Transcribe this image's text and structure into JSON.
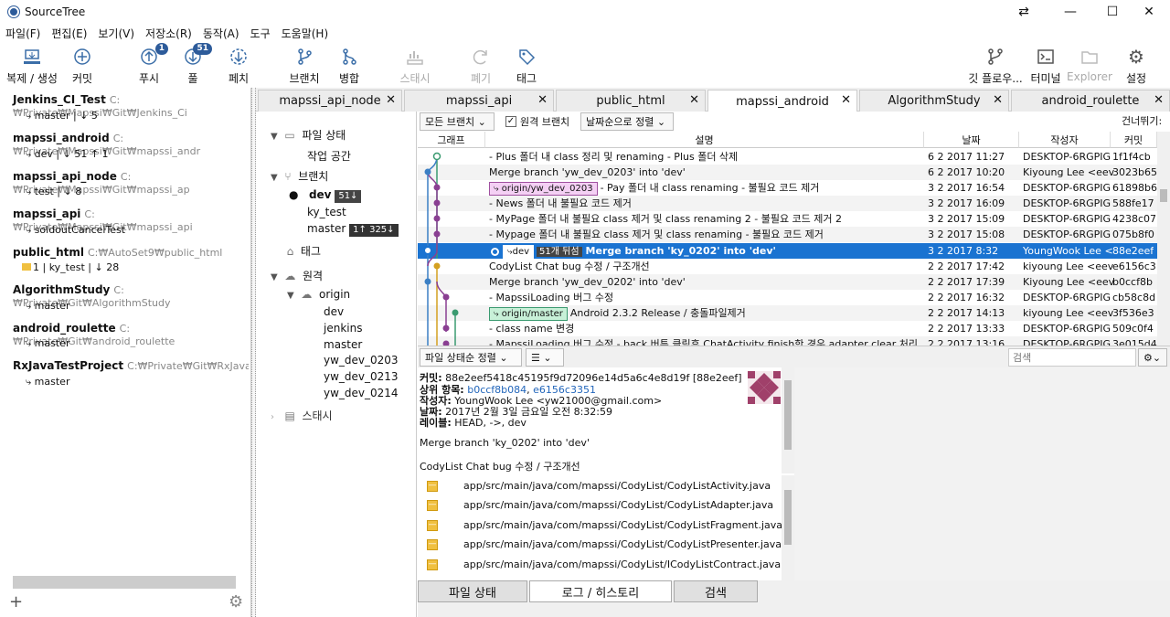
{
  "window": {
    "title": "SourceTree",
    "controls": [
      "⇄",
      "—",
      "☐",
      "✕"
    ]
  },
  "menu": [
    "파일(F)",
    "편집(E)",
    "보기(V)",
    "저장소(R)",
    "동작(A)",
    "도구",
    "도움말(H)"
  ],
  "toolbar": {
    "clone": "복제 / 생성",
    "commit": "커밋",
    "push": "푸시",
    "push_badge": "1",
    "pull": "풀",
    "pull_badge": "51",
    "fetch": "페치",
    "branch": "브랜치",
    "merge": "병합",
    "stash": "스태시",
    "discard": "폐기",
    "tag": "태그",
    "gitflow": "깃 플로우...",
    "terminal": "터미널",
    "explorer": "Explorer",
    "settings": "설정"
  },
  "repos": [
    {
      "name": "Jenkins_CI_Test",
      "path": "C:₩Private₩Mapssi₩Git₩Jenkins_Ci",
      "branch": "master  |  ↓ 5"
    },
    {
      "name": "mapssi_android",
      "path": "C:₩Private₩Mapssi₩Git₩mapssi_andr",
      "branch": "dev  |  ↓ 51  ↑ 1"
    },
    {
      "name": "mapssi_api_node",
      "path": "C:₩Private₩Mapssi₩Git₩mapssi_ap",
      "branch": "test  |  ↓ 8"
    },
    {
      "name": "mapssi_api",
      "path": "C:₩Private₩Mapssi₩Git₩mapssi_api",
      "branch": "soldoutCancelTest"
    },
    {
      "name": "public_html",
      "path": "C:₩AutoSet9₩public_html",
      "branch": "1  |  ky_test  |  ↓ 28"
    },
    {
      "name": "AlgorithmStudy",
      "path": "C:₩Private₩Git₩AlgorithmStudy",
      "branch": "master"
    },
    {
      "name": "android_roulette",
      "path": "C:₩Private₩Git₩android_roulette",
      "branch": "master"
    },
    {
      "name": "RxJavaTestProject",
      "path": "C:₩Private₩Git₩RxJavaTestProjec",
      "branch": "master"
    }
  ],
  "left_footer": {
    "add": "+",
    "gear": "⚙"
  },
  "tabs": [
    "mapssi_api_node",
    "mapssi_api",
    "public_html",
    "mapssi_android",
    "AlgorithmStudy",
    "android_roulette"
  ],
  "sidebar": {
    "file_status": "파일 상태",
    "workspace": "작업 공간",
    "branches": "브랜치",
    "dev": "dev",
    "dev_count": "51↓",
    "ky_test": "ky_test",
    "master": "master",
    "master_count": "1↑ 325↓",
    "tags": "태그",
    "remotes": "원격",
    "origin": "origin",
    "remote_branches": [
      "dev",
      "jenkins",
      "master",
      "yw_dev_0203",
      "yw_dev_0213",
      "yw_dev_0214"
    ],
    "stash": "스태시"
  },
  "filters": {
    "all_branches": "모든 브랜치",
    "remote_branches": "원격 브랜치",
    "sort": "날짜순으로 정렬",
    "skip": "건너뛰기:"
  },
  "grid": {
    "headers": [
      "그래프",
      "설명",
      "날짜",
      "작성자",
      "커밋"
    ],
    "rows": [
      {
        "tags": [],
        "desc": "- Plus 폴더 내 class 정리 및 renaming - Plus 폴더 삭제",
        "date": "6 2 2017 11:27",
        "author": "DESKTOP-6RGPIG",
        "commit": "1f1f4cb"
      },
      {
        "tags": [],
        "desc": "Merge branch 'yw_dev_0203' into 'dev'",
        "date": "6 2 2017 10:20",
        "author": "Kiyoung Lee <eev",
        "commit": "3023b65"
      },
      {
        "tags": [
          "origin/yw_dev_0203"
        ],
        "desc": "- Pay 폴더 내 class renaming - 불필요 코드 제거",
        "date": "3 2 2017 16:54",
        "author": "DESKTOP-6RGPIG",
        "commit": "61898b6"
      },
      {
        "tags": [],
        "desc": "- News 폴더 내 불필요 코드 제거",
        "date": "3 2 2017 16:09",
        "author": "DESKTOP-6RGPIG",
        "commit": "588fe17"
      },
      {
        "tags": [],
        "desc": "- MyPage 폴더 내 불필요 class 제거 및 class renaming 2 - 불필요  코드 제거 2",
        "date": "3 2 2017 15:09",
        "author": "DESKTOP-6RGPIG",
        "commit": "4238c07"
      },
      {
        "tags": [],
        "desc": "- Mypage 폴더 내 불필요 class 제거 및 class renaming - 불필요 코드 제거",
        "date": "3 2 2017 15:08",
        "author": "DESKTOP-6RGPIG",
        "commit": "075b8f0"
      },
      {
        "tags": [
          "dev",
          "51개 뒤섬"
        ],
        "desc": "Merge branch 'ky_0202' into 'dev'",
        "date": "3 2 2017 8:32",
        "author": "YoungWook Lee <",
        "commit": "88e2eef"
      },
      {
        "tags": [],
        "desc": "CodyList Chat bug 수정 / 구조개선",
        "date": "2 2 2017 17:42",
        "author": "kiyoung Lee <eev",
        "commit": "e6156c3"
      },
      {
        "tags": [],
        "desc": "Merge branch 'yw_dev_0202' into 'dev'",
        "date": "2 2 2017 17:39",
        "author": "Kiyoung Lee <eev",
        "commit": "b0ccf8b"
      },
      {
        "tags": [],
        "desc": "- MapssiLoading 버그 수정",
        "date": "2 2 2017 16:32",
        "author": "DESKTOP-6RGPIG",
        "commit": "cb58c8d"
      },
      {
        "tags": [
          "origin/master"
        ],
        "desc": "Android 2.3.2 Release / 충돌파일제거",
        "date": "2 2 2017 14:13",
        "author": "kiyoung Lee <eev",
        "commit": "3f536e3"
      },
      {
        "tags": [],
        "desc": "- class name 변경",
        "date": "2 2 2017 13:33",
        "author": "DESKTOP-6RGPIG",
        "commit": "509c0f4"
      },
      {
        "tags": [],
        "desc": "- MapssiLoading 버그 수정 - back 버튼 클릭후 ChatActivity finish한 경우 adapter clear 처리",
        "date": "2 2 2017 13:16",
        "author": "DESKTOP-6RGPIG",
        "commit": "3e015d4"
      }
    ]
  },
  "midbar": {
    "sort": "파일 상태순 정렬",
    "list": "☰",
    "search_placeholder": "검색"
  },
  "detail": {
    "commit_label": "커밋:",
    "commit": "88e2eef5418c45195f9d72096e14d5a6c4e8d19f [88e2eef]",
    "parents_label": "상위 항목:",
    "parent1": "b0ccf8b084",
    "parent2": "e6156c3351",
    "author_label": "작성자:",
    "author": "YoungWook Lee <yw21000@gmail.com>",
    "date_label": "날짜:",
    "date": "2017년 2월 3일 금요일 오전 8:32:59",
    "labels_label": "레이블:",
    "labels": "HEAD, ->, dev",
    "message1": "Merge branch 'ky_0202' into 'dev'",
    "message2": "CodyList Chat bug 수정 / 구조개선"
  },
  "files": [
    "app/src/main/java/com/mapssi/CodyList/CodyListActivity.java",
    "app/src/main/java/com/mapssi/CodyList/CodyListAdapter.java",
    "app/src/main/java/com/mapssi/CodyList/CodyListFragment.java",
    "app/src/main/java/com/mapssi/CodyList/CodyListPresenter.java",
    "app/src/main/java/com/mapssi/CodyList/ICodyListContract.java"
  ],
  "bottom_tabs": [
    "파일 상태",
    "로그 / 히스토리",
    "검색"
  ],
  "colors": {
    "accent": "#1a73d1",
    "branch_green": "#3a9a70",
    "branch_purple": "#8a3f92",
    "branch_yellow": "#d4a020",
    "branch_blue": "#3b7fc4"
  }
}
